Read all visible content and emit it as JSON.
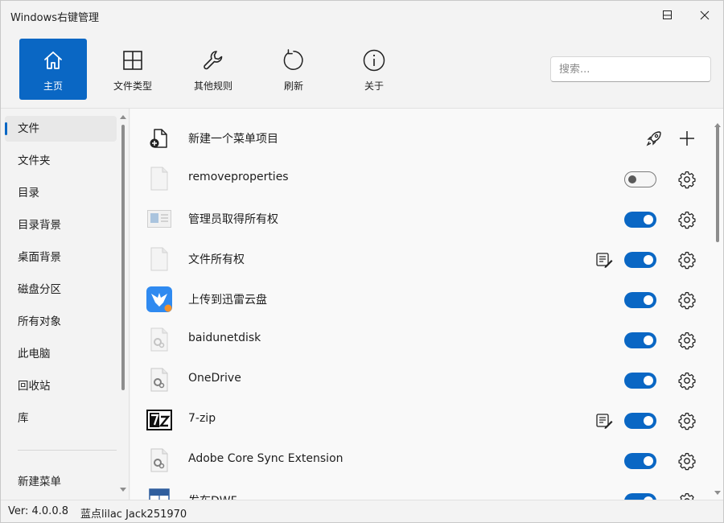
{
  "window": {
    "title": "Windows右键管理"
  },
  "toolbar": {
    "items": [
      {
        "label": "主页",
        "icon": "home-icon",
        "active": true
      },
      {
        "label": "文件类型",
        "icon": "grid-icon",
        "active": false
      },
      {
        "label": "其他规则",
        "icon": "wrench-icon",
        "active": false
      },
      {
        "label": "刷新",
        "icon": "refresh-icon",
        "active": false
      },
      {
        "label": "关于",
        "icon": "info-icon",
        "active": false
      }
    ],
    "search_placeholder": "搜索..."
  },
  "sidebar": {
    "items": [
      {
        "label": "文件",
        "selected": true
      },
      {
        "label": "文件夹"
      },
      {
        "label": "目录"
      },
      {
        "label": "目录背景"
      },
      {
        "label": "桌面背景"
      },
      {
        "label": "磁盘分区"
      },
      {
        "label": "所有对象"
      },
      {
        "label": "此电脑"
      },
      {
        "label": "回收站"
      },
      {
        "label": "库"
      }
    ],
    "bottom_item": "新建菜单"
  },
  "main": {
    "rows": [
      {
        "label": "新建一个菜单项目",
        "icon": "new-file-icon",
        "kind": "new"
      },
      {
        "label": "removeproperties",
        "icon": "blank-file-icon",
        "enabled": false,
        "edit": false
      },
      {
        "label": "管理员取得所有权",
        "icon": "window-file-icon",
        "enabled": true,
        "edit": false
      },
      {
        "label": "文件所有权",
        "icon": "blank-file-icon",
        "enabled": true,
        "edit": true
      },
      {
        "label": "上传到迅雷云盘",
        "icon": "xunlei-bird-icon",
        "enabled": true,
        "edit": false
      },
      {
        "label": "baidunetdisk",
        "icon": "gear-file-icon",
        "enabled": true,
        "edit": false
      },
      {
        "label": "OneDrive",
        "icon": "gear-file-icon",
        "enabled": true,
        "edit": false
      },
      {
        "label": "7-zip",
        "icon": "sevenzip-icon",
        "enabled": true,
        "edit": true
      },
      {
        "label": "Adobe Core Sync Extension",
        "icon": "gear-file-icon",
        "enabled": true,
        "edit": false
      },
      {
        "label": "发布DWF",
        "icon": "dwf-icon",
        "enabled": true,
        "edit": false
      }
    ]
  },
  "status": {
    "version": "Ver: 4.0.0.8",
    "author": "蓝点lilac Jack251970"
  },
  "colors": {
    "accent": "#0a67c4",
    "background": "#f3f3f3",
    "list_background": "#f9f9f9"
  }
}
